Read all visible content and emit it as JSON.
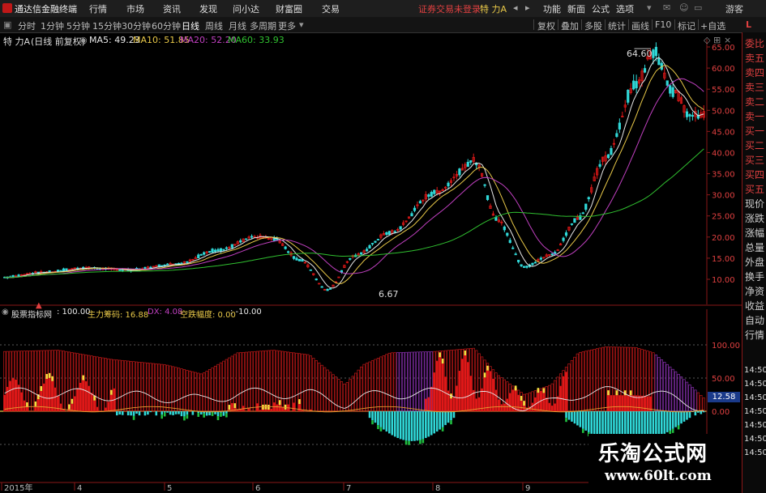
{
  "app": {
    "title": "通达信金融终端"
  },
  "menu": {
    "items": [
      "行情",
      "市场",
      "资讯",
      "发现",
      "问小达",
      "财富圈",
      "交易"
    ],
    "status": "证券交易未登录",
    "stock": "特 力A",
    "right_items": [
      "功能",
      "新面",
      "公式",
      "选项"
    ],
    "guest": "游客"
  },
  "periods": [
    "分时",
    "1分钟",
    "5分钟",
    "15分钟",
    "30分钟",
    "60分钟",
    "日线",
    "周线",
    "月线",
    "多周期",
    "更多"
  ],
  "active_period": "日线",
  "toolbar_right": [
    "复权",
    "叠加",
    "多股",
    "统计",
    "画线",
    "F10",
    "标记",
    "+自选"
  ],
  "main_chart": {
    "header": {
      "name": "特 力A",
      "mode": "(日线 前复权)",
      "ma5": "MA5: 49.23",
      "ma10": "MA10: 51.85",
      "ma20": "MA20: 52.20",
      "ma60": "MA60: 33.93"
    },
    "yticks": [
      "65.00",
      "60.00",
      "55.00",
      "50.00",
      "45.00",
      "40.00",
      "35.00",
      "30.00",
      "25.00",
      "20.00",
      "15.00",
      "10.00"
    ],
    "high_label": "64.60",
    "low_label": "6.67"
  },
  "indicator": {
    "name": "股票指标网",
    "val": ": 100.00",
    "zl": "主力筹码: 16.88",
    "dx": "DX: 4.08",
    "kd": "空跌幅度: 0.00",
    "neg": ": -10.00",
    "yticks": [
      "100.00",
      "50.00",
      "0.00",
      "-50.00"
    ],
    "cur_badge": "12.58",
    "right_times": [
      "14:50",
      "14:50",
      "14:50",
      "14:50",
      "14:50",
      "14:50",
      "14:50"
    ]
  },
  "xaxis": {
    "labels": [
      "2015年",
      "4",
      "5",
      "6",
      "7",
      "8",
      "9"
    ]
  },
  "right_panel": {
    "items": [
      "委比",
      "卖五",
      "卖四",
      "卖三",
      "卖二",
      "卖一",
      "买一",
      "买二",
      "买三",
      "买四",
      "买五",
      "现价",
      "涨跌",
      "涨幅",
      "总量",
      "外盘",
      "换手",
      "净资",
      "收益",
      "自动",
      "行情"
    ]
  },
  "watermark": {
    "title": "乐淘公式网",
    "url": "www.60lt.com"
  },
  "colors": {
    "up": "#e01818",
    "down": "#30d8d8",
    "ma5": "#e8e8e8",
    "ma10": "#e8c848",
    "ma20": "#c040c0",
    "ma60": "#30c030",
    "accent": "#e02020"
  }
}
